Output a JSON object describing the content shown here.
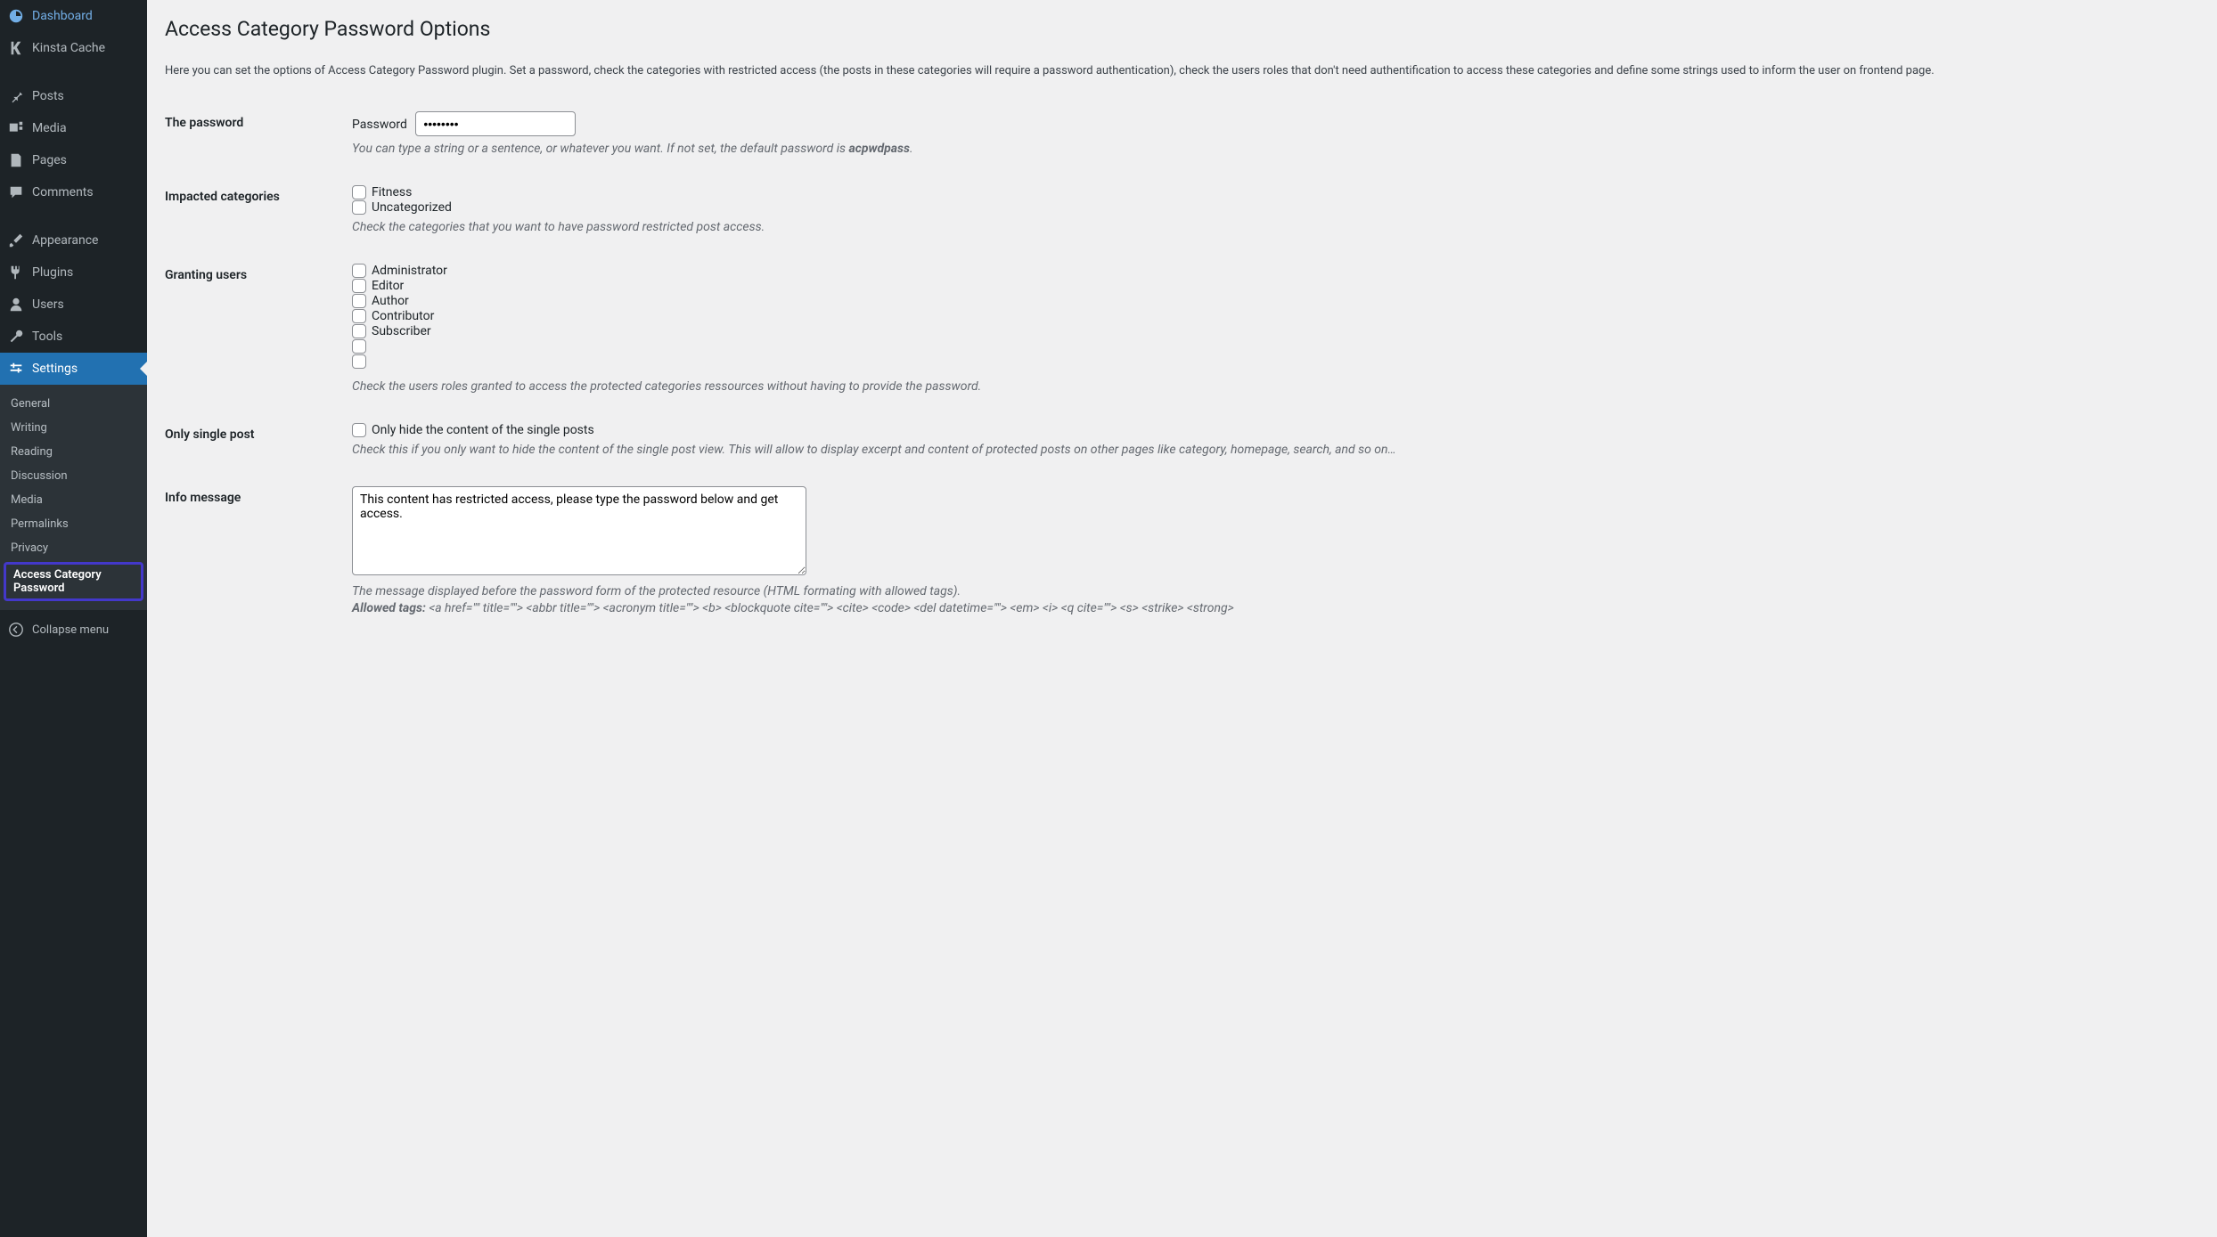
{
  "sidebar": {
    "items": [
      {
        "label": "Dashboard"
      },
      {
        "label": "Kinsta Cache"
      },
      {
        "label": "Posts"
      },
      {
        "label": "Media"
      },
      {
        "label": "Pages"
      },
      {
        "label": "Comments"
      },
      {
        "label": "Appearance"
      },
      {
        "label": "Plugins"
      },
      {
        "label": "Users"
      },
      {
        "label": "Tools"
      },
      {
        "label": "Settings"
      }
    ],
    "submenu": [
      {
        "label": "General"
      },
      {
        "label": "Writing"
      },
      {
        "label": "Reading"
      },
      {
        "label": "Discussion"
      },
      {
        "label": "Media"
      },
      {
        "label": "Permalinks"
      },
      {
        "label": "Privacy"
      },
      {
        "label": "Access Category Password"
      }
    ],
    "collapse": "Collapse menu"
  },
  "page": {
    "title": "Access Category Password Options",
    "intro": "Here you can set the options of Access Category Password plugin. Set a password, check the categories with restricted access (the posts in these categories will require a password authentication), check the users roles that don't need authentification to access these categories and define some strings used to inform the user on frontend page."
  },
  "form": {
    "password": {
      "heading": "The password",
      "label": "Password",
      "value": "••••••••",
      "desc_prefix": "You can type a string or a sentence, or whatever you want. If not set, the default password is ",
      "desc_strong": "acpwdpass",
      "desc_suffix": "."
    },
    "categories": {
      "heading": "Impacted categories",
      "items": [
        "Fitness",
        "Uncategorized"
      ],
      "desc": "Check the categories that you want to have password restricted post access."
    },
    "users": {
      "heading": "Granting users",
      "items": [
        "Administrator",
        "Editor",
        "Author",
        "Contributor",
        "Subscriber",
        "",
        ""
      ],
      "desc": "Check the users roles granted to access the protected categories ressources without having to provide the password."
    },
    "single": {
      "heading": "Only single post",
      "checkbox_label": "Only hide the content of the single posts",
      "desc": "Check this if you only want to hide the content of the single post view. This will allow to display excerpt and content of protected posts on other pages like category, homepage, search, and so on…"
    },
    "info": {
      "heading": "Info message",
      "value": "This content has restricted access, please type the password below and get access.",
      "desc": "The message displayed before the password form of the protected resource (HTML formating with allowed tags).",
      "allowed_label": "Allowed tags: ",
      "allowed_tags": "<a href=\"\" title=\"\"> <abbr title=\"\"> <acronym title=\"\"> <b> <blockquote cite=\"\"> <cite> <code> <del datetime=\"\"> <em> <i> <q cite=\"\"> <s> <strike> <strong>"
    }
  }
}
